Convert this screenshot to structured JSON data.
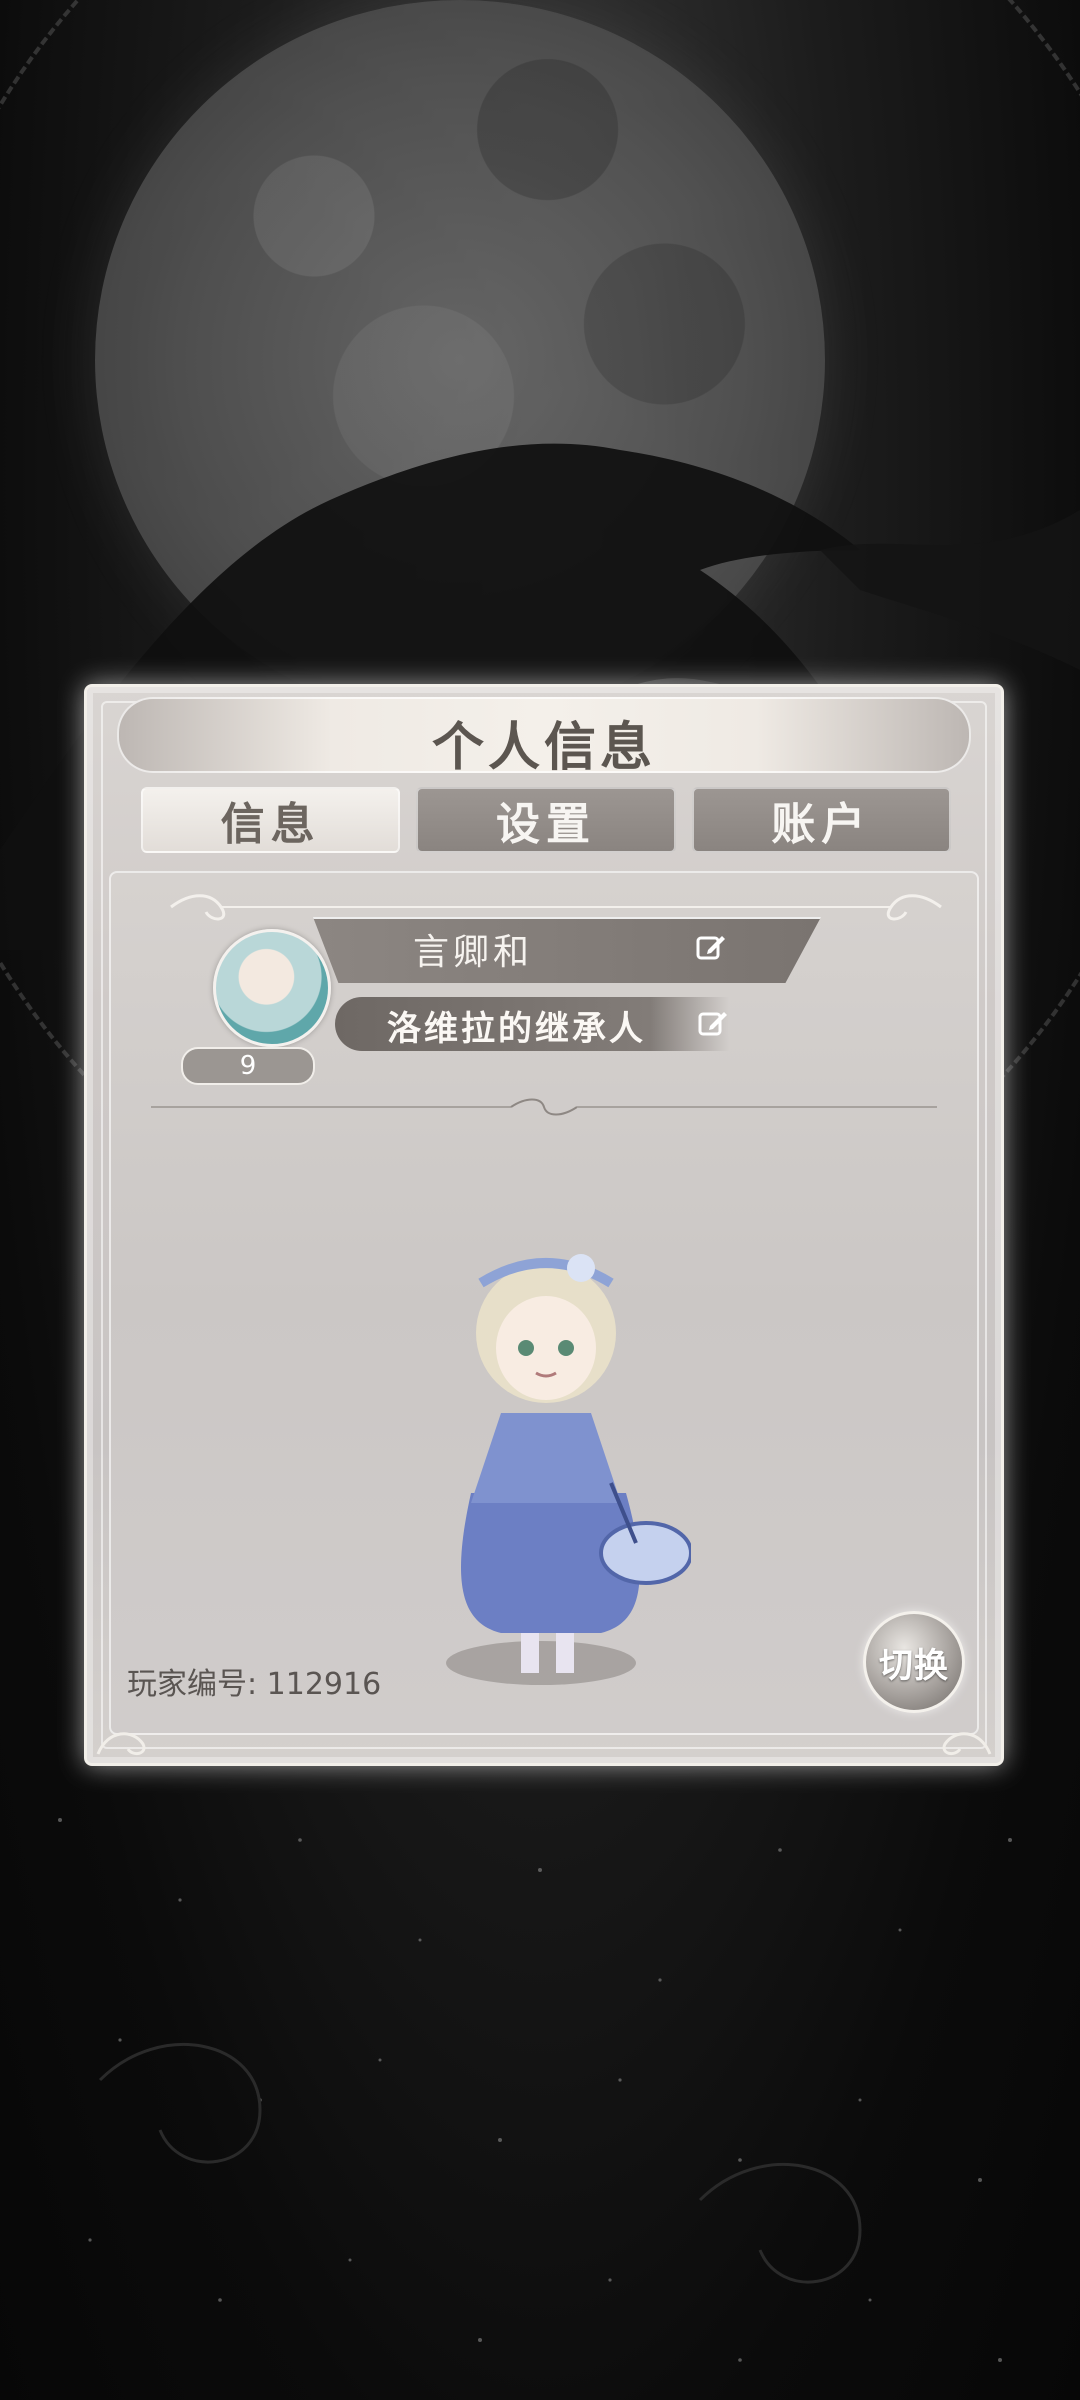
{
  "panel": {
    "title": "个人信息",
    "tabs": [
      {
        "label": "信息",
        "active": true
      },
      {
        "label": "设置",
        "active": false
      },
      {
        "label": "账户",
        "active": false
      }
    ]
  },
  "profile": {
    "level": "9",
    "name": "言卿和",
    "title": "洛维拉的继承人",
    "player_id_label": "玩家编号: 112916"
  },
  "actions": {
    "switch_label": "切换"
  },
  "colors": {
    "panel_bg": "#cfcac8",
    "tab_inactive": "#8a8480",
    "tab_active": "#efebe6",
    "accent_dark": "#5c5650"
  },
  "icons": [
    "edit-icon",
    "avatar",
    "flourish-ornament",
    "moon",
    "crow"
  ]
}
